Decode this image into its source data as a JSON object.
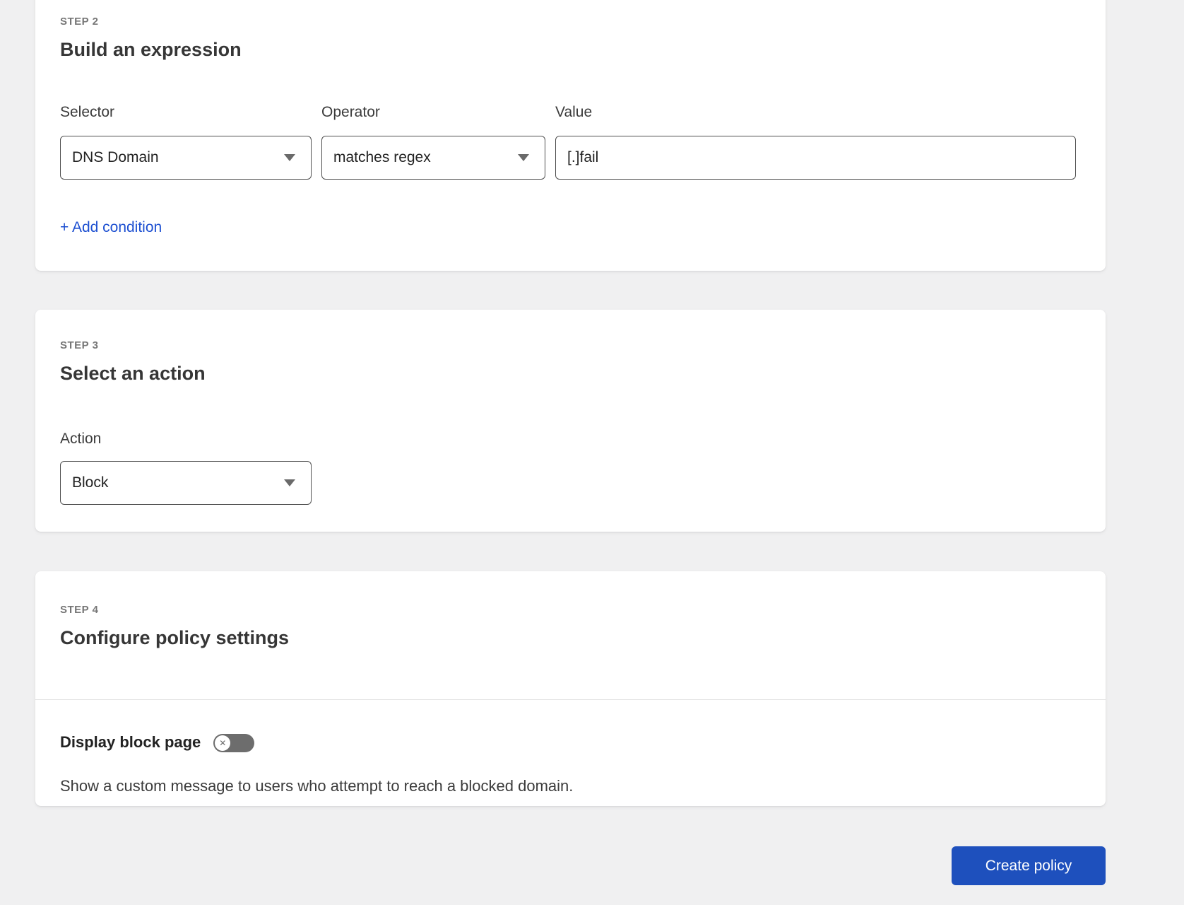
{
  "steps": {
    "expression": {
      "step_label": "STEP 2",
      "title": "Build an expression",
      "fields": {
        "selector": {
          "label": "Selector",
          "value": "DNS Domain"
        },
        "operator": {
          "label": "Operator",
          "value": "matches regex"
        },
        "value": {
          "label": "Value",
          "value": "[.]fail"
        }
      },
      "add_condition_label": "+ Add condition"
    },
    "action": {
      "step_label": "STEP 3",
      "title": "Select an action",
      "field": {
        "label": "Action",
        "value": "Block"
      }
    },
    "settings": {
      "step_label": "STEP 4",
      "title": "Configure policy settings",
      "display_block_page": {
        "label": "Display block page",
        "state": "off",
        "description": "Show a custom message to users who attempt to reach a blocked domain."
      }
    }
  },
  "footer": {
    "create_button_label": "Create policy"
  },
  "icons": {
    "toggle_off_glyph": "✕"
  },
  "colors": {
    "page_background": "#f0f0f1",
    "link_blue": "#1c4fd1",
    "button_blue": "#1e50bd",
    "toggle_off_gray": "#6d6d6d"
  }
}
